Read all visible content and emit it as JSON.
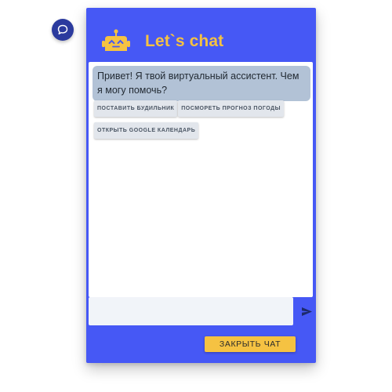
{
  "launcher": {
    "icon": "chat-bubble-icon"
  },
  "header": {
    "title": "Let`s chat",
    "icon": "robot-icon",
    "accent_color": "#f5c242"
  },
  "colors": {
    "window_background": "#4658f5",
    "bot_bubble": "#b2c2d6",
    "chip_background": "#e2e6ec",
    "button_background": "#f5c242",
    "launcher_background": "#2b3a9e"
  },
  "messages": [
    {
      "sender": "bot",
      "text": "Привет! Я твой виртуальный ассистент. Чем я могу помочь?"
    }
  ],
  "quick_replies": [
    "ПОСТАВИТЬ БУДИЛЬНИК",
    "ПОСМОРЕТЬ ПРОГНОЗ ПОГОДЫ",
    "ОТКРЫТЬ GOOGLE КАЛЕНДАРЬ"
  ],
  "composer": {
    "value": "",
    "placeholder": "",
    "send_icon": "send-icon"
  },
  "close_button": {
    "label": "ЗАКРЫТЬ ЧАТ"
  }
}
